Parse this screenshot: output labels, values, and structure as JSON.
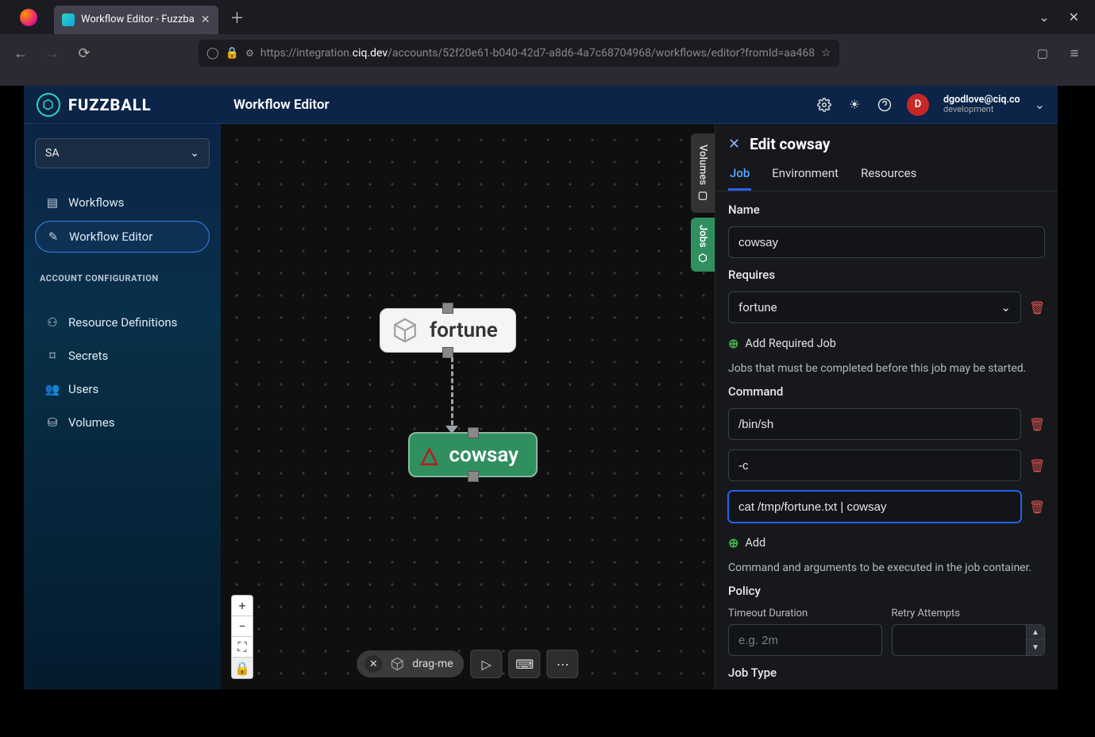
{
  "browser": {
    "tab_title": "Workflow Editor - Fuzzba",
    "url_scheme": "https://",
    "url_prefix": "integration.",
    "url_host": "ciq.dev",
    "url_path": "/accounts/52f20e61-b040-42d7-a8d6-4a7c68704968/workflows/editor?fromId=aa468"
  },
  "header": {
    "brand": "FUZZBALL",
    "page_title": "Workflow Editor",
    "user_initial": "D",
    "user_email": "dgodlove@ciq.co",
    "user_env": "development"
  },
  "sidebar": {
    "account": "SA",
    "items": [
      {
        "icon": "list",
        "label": "Workflows"
      },
      {
        "icon": "edit",
        "label": "Workflow Editor"
      }
    ],
    "section": "ACCOUNT CONFIGURATION",
    "config_items": [
      {
        "icon": "sitemap",
        "label": "Resource Definitions"
      },
      {
        "icon": "key",
        "label": "Secrets"
      },
      {
        "icon": "users",
        "label": "Users"
      },
      {
        "icon": "disk",
        "label": "Volumes"
      }
    ]
  },
  "canvas": {
    "node_fortune_label": "fortune",
    "node_cowsay_label": "cowsay",
    "volumes_tab": "Volumes",
    "jobs_tab": "Jobs",
    "drag_label": "drag-me"
  },
  "panel": {
    "title": "Edit cowsay",
    "tabs": {
      "job": "Job",
      "env": "Environment",
      "res": "Resources"
    },
    "name_label": "Name",
    "name_value": "cowsay",
    "requires_label": "Requires",
    "requires_selected": "fortune",
    "add_required": "Add Required Job",
    "requires_hint": "Jobs that must be completed before this job may be started.",
    "command_label": "Command",
    "command_args": [
      "/bin/sh",
      "-c",
      "cat /tmp/fortune.txt | cowsay"
    ],
    "add": "Add",
    "command_hint": "Command and arguments to be executed in the job container.",
    "policy_label": "Policy",
    "timeout_label": "Timeout Duration",
    "timeout_placeholder": "e.g. 2m",
    "retry_label": "Retry Attempts",
    "jobtype_label": "Job Type"
  }
}
